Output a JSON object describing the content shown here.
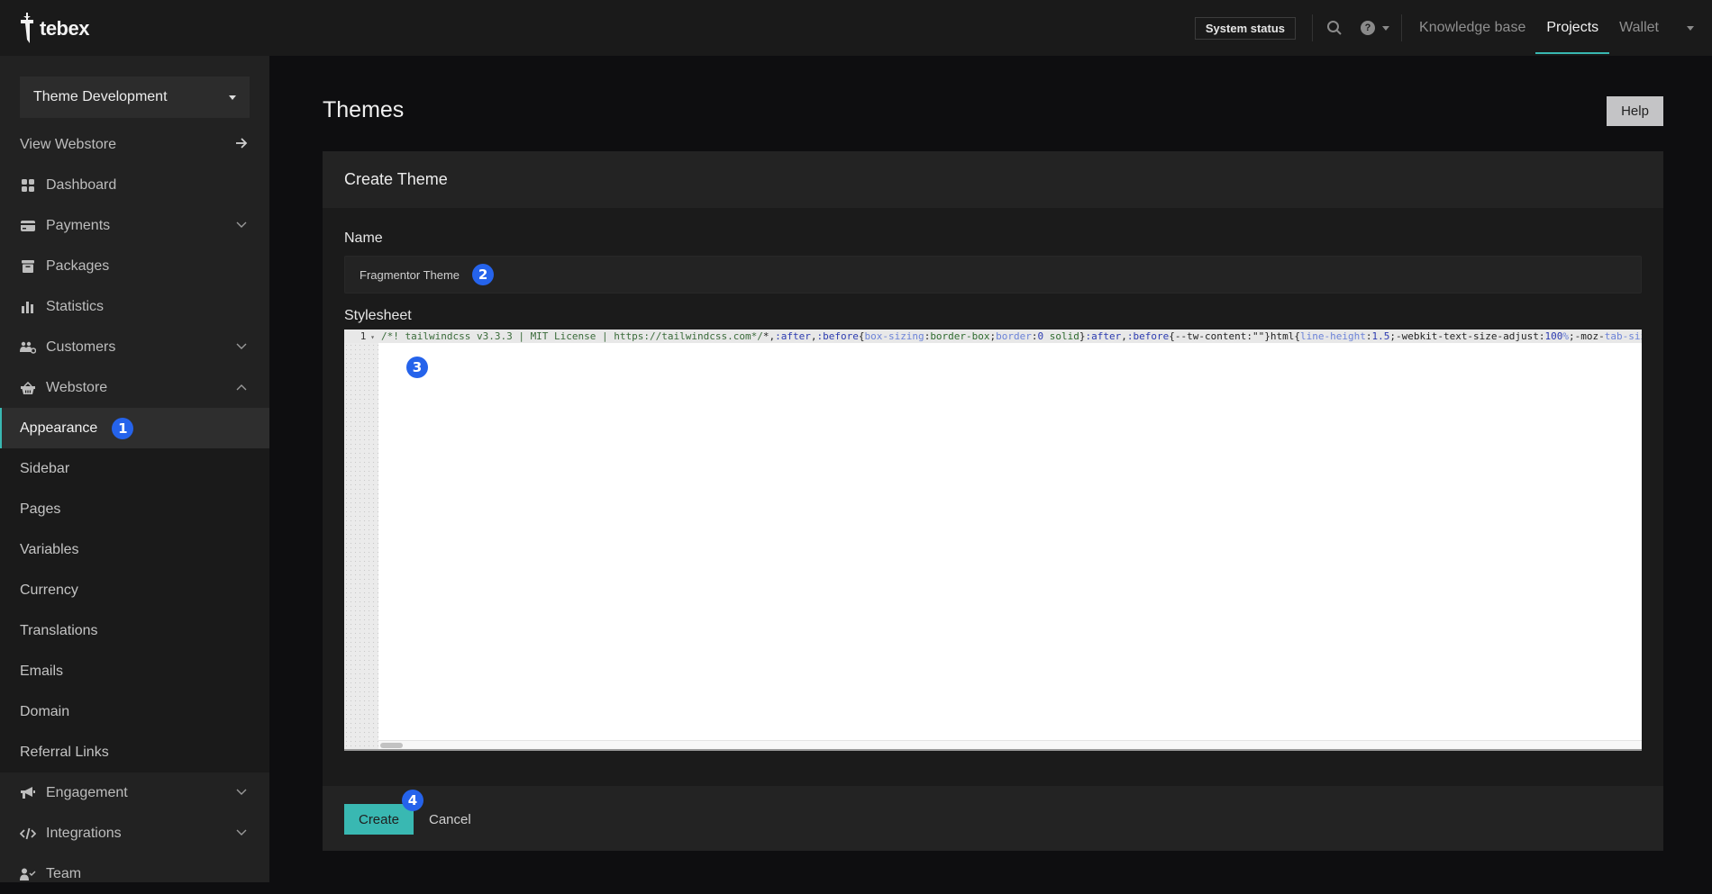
{
  "app": {
    "brand": "tebex",
    "accent_color": "#39b8b2",
    "badge_color": "#2563eb"
  },
  "topbar": {
    "system_status": "System status",
    "search_icon": "search-icon",
    "help_icon": "help-circle-icon",
    "help_icon_glyph": "?",
    "links": [
      {
        "label": "Knowledge base",
        "active": false
      },
      {
        "label": "Projects",
        "active": true
      },
      {
        "label": "Wallet",
        "active": false
      }
    ]
  },
  "sidebar": {
    "store_selector": "Theme Development",
    "view_webstore": "View Webstore",
    "items": [
      {
        "label": "Dashboard",
        "icon": "dashboard-icon",
        "expandable": false
      },
      {
        "label": "Payments",
        "icon": "credit-card-icon",
        "expandable": true,
        "expanded": false
      },
      {
        "label": "Packages",
        "icon": "archive-box-icon",
        "expandable": false
      },
      {
        "label": "Statistics",
        "icon": "bar-chart-icon",
        "expandable": false
      },
      {
        "label": "Customers",
        "icon": "users-cog-icon",
        "expandable": true,
        "expanded": false
      },
      {
        "label": "Webstore",
        "icon": "basket-icon",
        "expandable": true,
        "expanded": true
      }
    ],
    "webstore_subitems": [
      {
        "label": "Appearance",
        "active": true,
        "badge": "1"
      },
      {
        "label": "Sidebar"
      },
      {
        "label": "Pages"
      },
      {
        "label": "Variables"
      },
      {
        "label": "Currency"
      },
      {
        "label": "Translations"
      },
      {
        "label": "Emails"
      },
      {
        "label": "Domain"
      },
      {
        "label": "Referral Links"
      }
    ],
    "bottom_items": [
      {
        "label": "Engagement",
        "icon": "megaphone-icon",
        "expandable": true
      },
      {
        "label": "Integrations",
        "icon": "code-icon",
        "expandable": true
      },
      {
        "label": "Team",
        "icon": "user-check-icon",
        "expandable": false
      }
    ]
  },
  "main": {
    "page_title": "Themes",
    "help_button": "Help",
    "card": {
      "title": "Create Theme",
      "name_label": "Name",
      "name_value": "Fragmentor Theme",
      "name_badge": "2",
      "stylesheet_label": "Stylesheet",
      "editor_badge": "3",
      "editor_line_number": "1",
      "code_tokens": [
        {
          "t": "/*! tailwindcss v3.3.3 | MIT License | https://tailwindcss.com*/",
          "c": "comment"
        },
        {
          "t": "*,",
          "c": "plain"
        },
        {
          "t": ":after",
          "c": "sel"
        },
        {
          "t": ",",
          "c": "plain"
        },
        {
          "t": ":before",
          "c": "sel"
        },
        {
          "t": "{",
          "c": "plain"
        },
        {
          "t": "box-sizing",
          "c": "prop"
        },
        {
          "t": ":",
          "c": "plain"
        },
        {
          "t": "border-box",
          "c": "val"
        },
        {
          "t": ";",
          "c": "plain"
        },
        {
          "t": "border",
          "c": "prop"
        },
        {
          "t": ":",
          "c": "plain"
        },
        {
          "t": "0",
          "c": "num"
        },
        {
          "t": " solid",
          "c": "val"
        },
        {
          "t": "}",
          "c": "plain"
        },
        {
          "t": ":after",
          "c": "sel"
        },
        {
          "t": ",",
          "c": "plain"
        },
        {
          "t": ":before",
          "c": "sel"
        },
        {
          "t": "{--tw-content:\"\"}html{",
          "c": "plain"
        },
        {
          "t": "line-height",
          "c": "prop"
        },
        {
          "t": ":",
          "c": "plain"
        },
        {
          "t": "1.5",
          "c": "num"
        },
        {
          "t": ";-webkit-text-size-adjust:",
          "c": "plain"
        },
        {
          "t": "100",
          "c": "num"
        },
        {
          "t": "%",
          "c": "prop"
        },
        {
          "t": ";-moz-",
          "c": "plain"
        },
        {
          "t": "tab-size",
          "c": "prop"
        }
      ],
      "create_button": "Create",
      "create_badge": "4",
      "cancel_button": "Cancel"
    }
  }
}
